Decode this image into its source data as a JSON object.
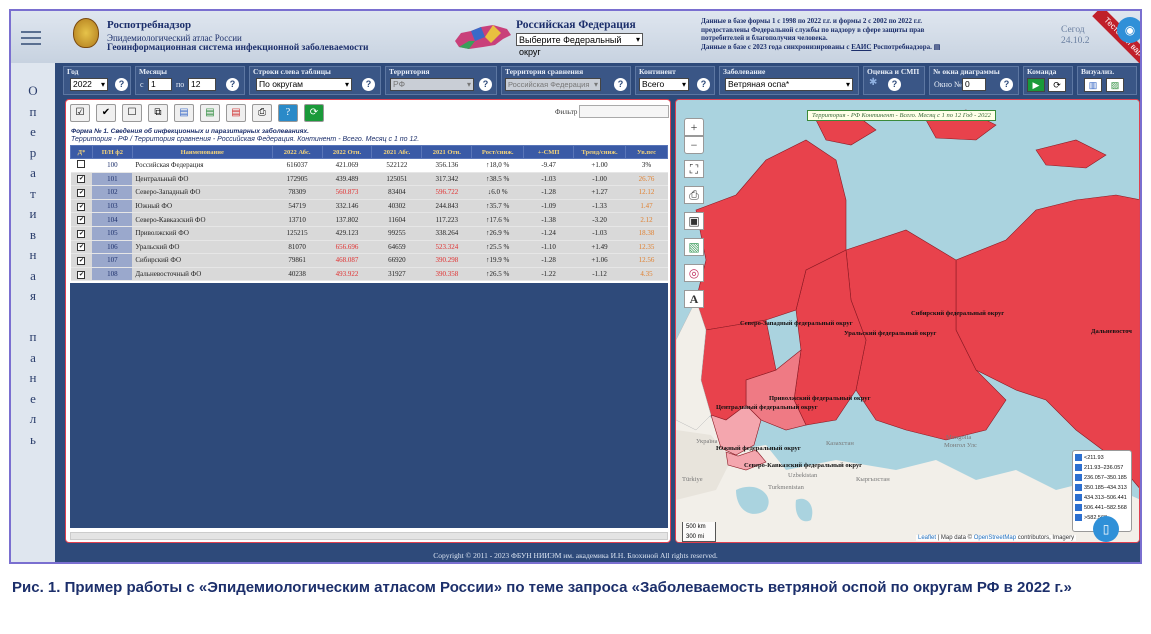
{
  "header": {
    "org": "Роспотребнадзор",
    "atlas": "Эпидемиологический атлас России",
    "gis": "Геоинформационная система инфекционной заболеваемости",
    "country": "Российская Федерация",
    "district_select": "Выберите Федеральный округ",
    "info_line1": "Данные в базе формы 1 с 1998 по 2022 г.г. и формы 2 с 2002 по 2022 г.г.",
    "info_line2": "предоставлены Федеральной службы по надзору в сфере защиты прав потребителей и благополучия человека.",
    "info_line3": "Данные в базе с 2023 года синхронизированы с",
    "info_link": "ЕАИС",
    "info_tail": "Роспотребнадзора.",
    "date1": "Сегод",
    "date2": "24.10.2",
    "ribbon": "Тестовый вариант",
    "camera_icon": "camera-icon"
  },
  "side_panel": [
    "О",
    "п",
    "е",
    "р",
    "а",
    "т",
    "и",
    "в",
    "н",
    "а",
    "я",
    "",
    "п",
    "а",
    "н",
    "е",
    "л",
    "ь"
  ],
  "toolbar": {
    "year_label": "Год",
    "year_value": "2022",
    "months_label": "Месяцы",
    "from_label": "с",
    "from_value": "1",
    "to_label": "по",
    "to_value": "12",
    "rows_label": "Строки слева таблицы",
    "rows_value": "По округам",
    "territory_label": "Территория",
    "territory_value": "РФ",
    "compare_label": "Территория сравнения",
    "compare_value": "Российская Федерация",
    "continent_label": "Континент",
    "continent_value": "Всего",
    "disease_label": "Заболевание",
    "disease_value": "Ветряная оспа*",
    "smp_label": "Оценка и СМП",
    "window_label": "№ окна диаграммы",
    "window_text": "Окно №",
    "window_value": "0",
    "command_label": "Команда",
    "visual_label": "Визуализ.",
    "help": "?"
  },
  "table_panel": {
    "filter_label": "Фильтр",
    "form_title": "Форма № 1. Сведения об инфекционных и паразитарных заболеваниях.",
    "form_subtitle": "Территория - РФ / Территория сравнения - Российская Федерация. Континент - Всего. Месяц с 1 по 12.",
    "headers": [
      "Д*",
      "П/Н ф2",
      "Наименование",
      "2022 Абс.",
      "2022 Отн.",
      "2021 Абс.",
      "2021 Отн.",
      "Рост/сниж.",
      "+-СМП",
      "Тренд/сниж.",
      "Ув.пес"
    ],
    "rows": [
      {
        "checked": false,
        "num": "100",
        "name": "Российская Федерация",
        "a22": "616037",
        "o22": "421.069",
        "a21": "522122",
        "o21": "356.136",
        "rost": "↑18,0 %",
        "smp": "-9.47",
        "trend": "+1.00",
        "uv": "3%",
        "c22": "",
        "cuv": ""
      },
      {
        "checked": true,
        "num": "101",
        "name": "Центральный ФО",
        "a22": "172905",
        "o22": "439.489",
        "a21": "125051",
        "o21": "317.342",
        "rost": "↑38.5 %",
        "smp": "-1.03",
        "trend": "-1.00",
        "uv": "26.76",
        "c22": "",
        "cuv": "orn"
      },
      {
        "checked": true,
        "num": "102",
        "name": "Северо-Западный ФО",
        "a22": "78309",
        "o22": "560.873",
        "a21": "83404",
        "o21": "596.722",
        "rost": "↓6.0 %",
        "smp": "-1.28",
        "trend": "+1.27",
        "uv": "12.12",
        "c22": "red",
        "cuv": "orn"
      },
      {
        "checked": true,
        "num": "103",
        "name": "Южный ФО",
        "a22": "54719",
        "o22": "332.146",
        "a21": "40302",
        "o21": "244.843",
        "rost": "↑35.7 %",
        "smp": "-1.09",
        "trend": "-1.33",
        "uv": "1.47",
        "c22": "",
        "cuv": "orn"
      },
      {
        "checked": true,
        "num": "104",
        "name": "Северо-Кавказский ФО",
        "a22": "13710",
        "o22": "137.802",
        "a21": "11604",
        "o21": "117.223",
        "rost": "↑17.6 %",
        "smp": "-1.38",
        "trend": "-3.20",
        "uv": "2.12",
        "c22": "",
        "cuv": "orn"
      },
      {
        "checked": true,
        "num": "105",
        "name": "Приволжский ФО",
        "a22": "125215",
        "o22": "429.123",
        "a21": "99255",
        "o21": "338.264",
        "rost": "↑26.9 %",
        "smp": "-1.24",
        "trend": "-1.03",
        "uv": "18.38",
        "c22": "",
        "cuv": "orn"
      },
      {
        "checked": true,
        "num": "106",
        "name": "Уральский ФО",
        "a22": "81070",
        "o22": "656.696",
        "a21": "64659",
        "o21": "523.324",
        "rost": "↑25.5 %",
        "smp": "-1.10",
        "trend": "+1.49",
        "uv": "12.35",
        "c22": "red",
        "cuv": "orn"
      },
      {
        "checked": true,
        "num": "107",
        "name": "Сибирский ФО",
        "a22": "79861",
        "o22": "468.087",
        "a21": "66920",
        "o21": "390.298",
        "rost": "↑19.9 %",
        "smp": "-1.28",
        "trend": "+1.06",
        "uv": "12.56",
        "c22": "red",
        "cuv": "orn"
      },
      {
        "checked": true,
        "num": "108",
        "name": "Дальневосточный ФО",
        "a22": "40238",
        "o22": "493.922",
        "a21": "31927",
        "o21": "390.358",
        "rost": "↑26.5 %",
        "smp": "-1.22",
        "trend": "-1.12",
        "uv": "4.35",
        "c22": "red",
        "cuv": "orn"
      }
    ]
  },
  "map": {
    "title": "Территория - РФ Континент - Всего. Месяц с 1 по 12 Год - 2022",
    "zoom_in": "+",
    "zoom_out": "−",
    "labels": [
      "Северо-Западный федеральный округ",
      "Уральский федеральный округ",
      "Сибирский федеральный округ",
      "Дальневосточ",
      "Приволжский федеральный округ",
      "Центральный федеральный округ",
      "Южный федеральный округ",
      "Северо-Кавказский федеральный округ"
    ],
    "geo_labels": [
      "Україна",
      "Казахстан",
      "Mongolia",
      "Монгол Улс",
      "Uzbekistan",
      "Turkmenistan",
      "Кыргызстан",
      "Türkiye"
    ],
    "legend": [
      "<211.93",
      "211.93–236.057",
      "236.057–350.185",
      "350.185–434.313",
      "434.313–506.441",
      "506.441–582.568",
      ">582.568"
    ],
    "scale_km": "500 km",
    "scale_mi": "300 mi",
    "attribution_link": "Leaflet",
    "attribution_text": "| Map data ©",
    "attribution_osm": "OpenStreetMap",
    "attribution_tail": "contributors, Imagery",
    "colors": {
      "high": "#e8424c",
      "mid": "#ef7a84",
      "low": "#f4a6ae",
      "border": "#8a1a24"
    }
  },
  "footer": "Copyright © 2011 - 2023 ФБУН НИИЭМ им. академика И.Н. Блохиной All rights reserved.",
  "caption": "Рис. 1. Пример работы с «Эпидемиологическим атласом России» по теме запроса «Заболеваемость ветряной оспой по округам РФ в 2022 г.»"
}
